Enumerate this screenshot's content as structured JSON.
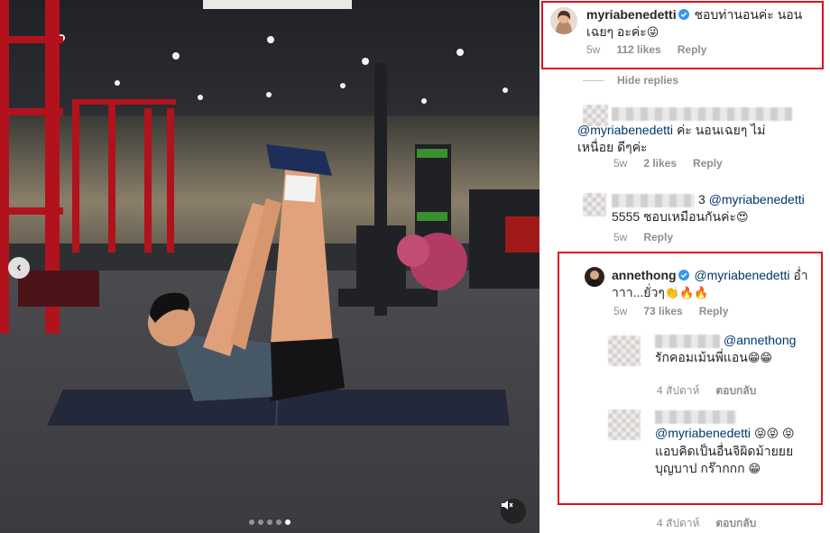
{
  "media": {
    "carousel_total": 5,
    "carousel_active": 5,
    "prev_icon": "chevron-left-icon",
    "mute_icon": "speaker-muted-icon"
  },
  "comments": {
    "hide_replies_label": "Hide replies",
    "top": {
      "username": "myriabenedetti",
      "verified": true,
      "text": "ชอบท่านอนค่ะ นอนเฉยๆ อะค่ะ",
      "emoji": "😜",
      "time": "5w",
      "likes": "112 likes",
      "reply_label": "Reply"
    },
    "reply1": {
      "mention": "@myriabenedetti",
      "text": "ค่ะ นอนเฉยๆ ไม่เหนื่อย ดีๆค่ะ",
      "time": "5w",
      "likes": "2 likes",
      "reply_label": "Reply"
    },
    "reply2": {
      "name_suffix": "3",
      "mention": "@myriabenedetti",
      "text": "5555 ชอบเหมือนกันค่ะ",
      "emoji": "😍",
      "time": "5w",
      "reply_label": "Reply"
    },
    "anne": {
      "username": "annethong",
      "verified": true,
      "mention": "@myriabenedetti",
      "text": "อ่ำาาา...ยั่วๆ",
      "emoji": "👏🔥🔥",
      "time": "5w",
      "likes": "73 likes",
      "reply_label": "Reply"
    },
    "reply3": {
      "mention": "@annethong",
      "text": "รักคอมเม้นพี่แอน",
      "emoji": "😁😁",
      "time": "4 สัปดาห์",
      "reply_label": "ตอบกลับ"
    },
    "reply4": {
      "mention": "@myriabenedetti",
      "emoji_a": "😝😝",
      "emoji_b": "😝",
      "text": "แอบคิดเป็นอื่นจิผิดม้ายยย บุญบาป กร๊ากกก",
      "emoji_c": "😁",
      "time": "4 สัปดาห์",
      "reply_label": "ตอบกลับ"
    },
    "footer": {
      "time": "4 สัปดาห์",
      "reply_label": "ตอบกลับ"
    }
  },
  "colors": {
    "highlight": "#e0101e",
    "verified": "#3897f0",
    "mention": "#00376b",
    "meta": "#8e8e8e"
  }
}
